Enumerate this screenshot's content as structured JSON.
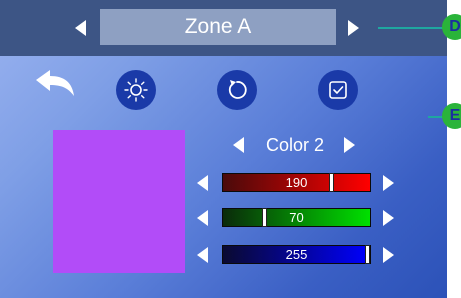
{
  "zone": {
    "label": "Zone A"
  },
  "color": {
    "label": "Color 2"
  },
  "swatch_color": "#b24cf8",
  "sliders": [
    {
      "name": "red",
      "value": "190",
      "level": 0.745,
      "gradient": [
        "#4a0a0a",
        "#ff0000"
      ]
    },
    {
      "name": "green",
      "value": "70",
      "level": 0.275,
      "gradient": [
        "#0a2a0a",
        "#00e000"
      ]
    },
    {
      "name": "blue",
      "value": "255",
      "level": 1.0,
      "gradient": [
        "#0a0a30",
        "#0000ff"
      ]
    }
  ],
  "callouts": [
    "D",
    "E"
  ],
  "icons": [
    "back-arrow-icon",
    "brightness-icon",
    "refresh-icon",
    "checkbox-icon"
  ]
}
